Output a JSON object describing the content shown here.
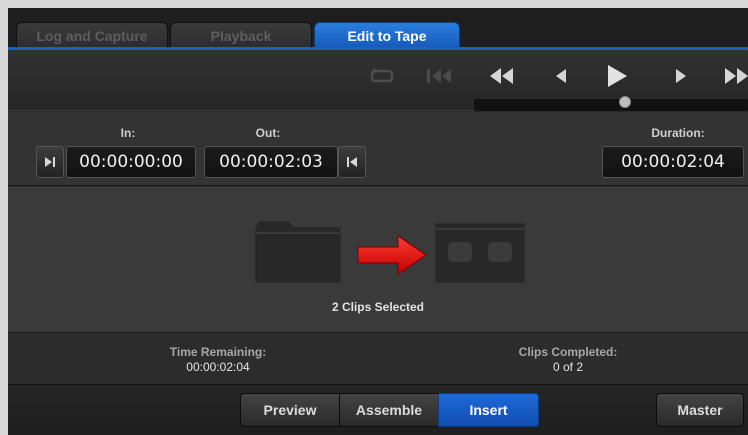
{
  "tabs": [
    {
      "label": "Log and Capture",
      "active": false
    },
    {
      "label": "Playback",
      "active": false
    },
    {
      "label": "Edit to Tape",
      "active": true
    }
  ],
  "timecode": {
    "in_label": "In:",
    "in_value": "00:00:00:00",
    "out_label": "Out:",
    "out_value": "00:00:02:03",
    "duration_label": "Duration:",
    "duration_value": "00:00:02:04"
  },
  "graphic": {
    "clips_selected": "2 Clips Selected"
  },
  "status": {
    "time_remaining_label": "Time Remaining:",
    "time_remaining_value": "00:00:02:04",
    "clips_completed_label": "Clips Completed:",
    "clips_completed_value": "0 of 2"
  },
  "buttons": {
    "preview": "Preview",
    "assemble": "Assemble",
    "insert": "Insert",
    "master": "Master"
  },
  "scrubber_position": 0.55,
  "colors": {
    "accent_blue": "#1d5fbf",
    "arrow_red": "#e01010",
    "icon_gray": "#4a4a4a"
  }
}
